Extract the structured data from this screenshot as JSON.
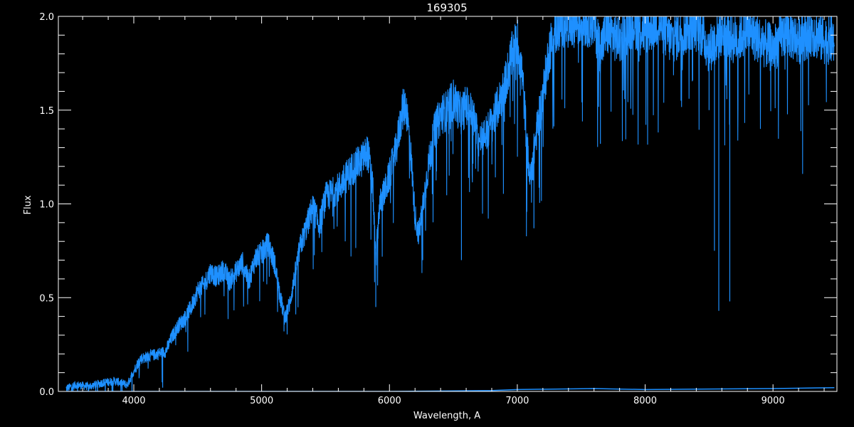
{
  "colors": {
    "background": "#000000",
    "axis": "#ffffff",
    "spectrum": "#1e90ff",
    "error": "#1e90ff"
  },
  "chart_data": {
    "type": "line",
    "title": "169305",
    "xlabel": "Wavelength, A",
    "ylabel": "Flux",
    "xlim": [
      3410,
      9500
    ],
    "ylim": [
      0.0,
      2.0
    ],
    "x_ticks": [
      4000,
      5000,
      6000,
      7000,
      8000,
      9000
    ],
    "x_tick_labels": [
      "4000",
      "5000",
      "6000",
      "7000",
      "8000",
      "9000"
    ],
    "y_ticks": [
      0.0,
      0.5,
      1.0,
      1.5,
      2.0
    ],
    "y_tick_labels": [
      "0.0",
      "0.5",
      "1.0",
      "1.5",
      "2.0"
    ],
    "x_minor_step": 200,
    "y_minor_step": 0.1,
    "grid": false,
    "series": [
      {
        "kind": "flux",
        "x": [
          3470,
          3550,
          3650,
          3750,
          3850,
          3950,
          3990,
          4050,
          4150,
          4250,
          4300,
          4350,
          4400,
          4450,
          4500,
          4550,
          4600,
          4650,
          4700,
          4750,
          4800,
          4850,
          4900,
          4950,
          5000,
          5050,
          5100,
          5150,
          5180,
          5220,
          5300,
          5400,
          5450,
          5500,
          5600,
          5700,
          5780,
          5830,
          5870,
          5893,
          5920,
          5980,
          6050,
          6100,
          6130,
          6160,
          6200,
          6230,
          6260,
          6300,
          6350,
          6400,
          6450,
          6500,
          6560,
          6600,
          6650,
          6700,
          6760,
          6800,
          6850,
          6900,
          6950,
          7000,
          7040,
          7080,
          7100,
          7120,
          7150,
          7200,
          7250,
          7300,
          7350,
          7400,
          7500,
          7600,
          7650,
          7700,
          7800,
          7900,
          8000,
          8100,
          8200,
          8300,
          8400,
          8500,
          8600,
          8700,
          8800,
          8900,
          9000,
          9100,
          9200,
          9300,
          9400,
          9480
        ],
        "y": [
          0.02,
          0.04,
          0.03,
          0.05,
          0.06,
          0.04,
          0.1,
          0.18,
          0.2,
          0.22,
          0.3,
          0.36,
          0.4,
          0.46,
          0.55,
          0.58,
          0.65,
          0.62,
          0.66,
          0.6,
          0.65,
          0.7,
          0.6,
          0.72,
          0.75,
          0.8,
          0.7,
          0.5,
          0.4,
          0.48,
          0.78,
          1.0,
          0.9,
          1.05,
          1.1,
          1.2,
          1.25,
          1.3,
          1.1,
          0.7,
          1.0,
          1.12,
          1.3,
          1.52,
          1.55,
          1.35,
          0.95,
          0.85,
          1.0,
          1.2,
          1.4,
          1.5,
          1.52,
          1.58,
          1.5,
          1.55,
          1.5,
          1.35,
          1.4,
          1.45,
          1.55,
          1.65,
          1.8,
          1.9,
          1.7,
          1.3,
          1.15,
          1.25,
          1.4,
          1.6,
          1.85,
          1.95,
          2.0,
          2.0,
          2.0,
          2.0,
          1.85,
          1.95,
          1.9,
          2.0,
          1.95,
          2.0,
          1.9,
          1.95,
          2.0,
          1.85,
          1.95,
          1.9,
          1.95,
          1.9,
          1.85,
          1.95,
          1.9,
          1.95,
          1.9,
          1.9
        ],
        "absorption_dips": [
          {
            "x": 4226,
            "y": 0.02
          },
          {
            "x": 5175,
            "y": 0.32
          },
          {
            "x": 5893,
            "y": 0.45
          },
          {
            "x": 6260,
            "y": 0.7
          },
          {
            "x": 6563,
            "y": 0.7
          },
          {
            "x": 7130,
            "y": 0.87
          },
          {
            "x": 7650,
            "y": 1.32
          },
          {
            "x": 8500,
            "y": 1.5
          },
          {
            "x": 8542,
            "y": 0.75
          },
          {
            "x": 8576,
            "y": 0.43
          },
          {
            "x": 8662,
            "y": 0.48
          }
        ]
      },
      {
        "kind": "error",
        "x": [
          3470,
          4000,
          5000,
          6000,
          6800,
          7000,
          7600,
          8000,
          9000,
          9480
        ],
        "y": [
          0.0,
          0.0,
          0.0,
          0.0,
          0.005,
          0.01,
          0.015,
          0.01,
          0.015,
          0.02
        ]
      }
    ]
  }
}
